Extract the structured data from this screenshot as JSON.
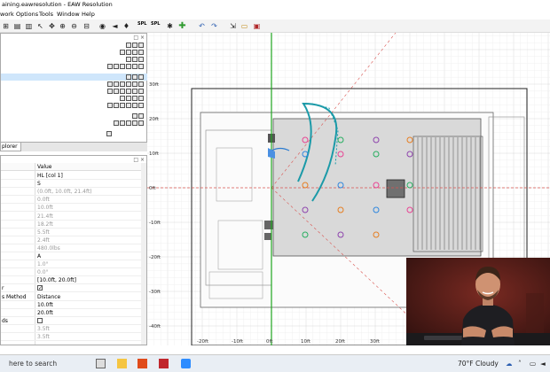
{
  "window": {
    "title": "aining.eawresolution - EAW Resolution"
  },
  "menu": [
    "work",
    "Options",
    "Tools",
    "Window",
    "Help"
  ],
  "toolbar": {
    "spl_label": "SPL"
  },
  "tree_panel": {
    "header": "□ ×"
  },
  "tabs": {
    "explorer": "plorer"
  },
  "props": {
    "header_value": "Value",
    "rows": [
      {
        "name": "",
        "value": "HL [col 1]",
        "dim": false,
        "check": ""
      },
      {
        "name": "",
        "value": "S",
        "dim": false,
        "check": ""
      },
      {
        "name": "",
        "value": "(0.0ft, 10.0ft, 21.4ft)",
        "dim": true,
        "check": ""
      },
      {
        "name": "",
        "value": "0.0ft",
        "dim": true,
        "check": ""
      },
      {
        "name": "",
        "value": "10.0ft",
        "dim": true,
        "check": ""
      },
      {
        "name": "",
        "value": "21.4ft",
        "dim": true,
        "check": ""
      },
      {
        "name": "",
        "value": "18.2ft",
        "dim": true,
        "check": ""
      },
      {
        "name": "",
        "value": "5.5ft",
        "dim": true,
        "check": ""
      },
      {
        "name": "",
        "value": "2.4ft",
        "dim": true,
        "check": ""
      },
      {
        "name": "",
        "value": "480.0lbs",
        "dim": true,
        "check": ""
      },
      {
        "name": "",
        "value": "A",
        "dim": false,
        "check": ""
      },
      {
        "name": "",
        "value": "1.0°",
        "dim": true,
        "check": ""
      },
      {
        "name": "",
        "value": "0.0°",
        "dim": true,
        "check": ""
      },
      {
        "name": "",
        "value": "[10.0ft, 20.0ft]",
        "dim": false,
        "check": ""
      },
      {
        "name": "r",
        "value": "",
        "dim": false,
        "check": "✓"
      },
      {
        "name": "s Method",
        "value": "Distance",
        "dim": false,
        "check": ""
      },
      {
        "name": "",
        "value": "10.0ft",
        "dim": false,
        "check": ""
      },
      {
        "name": "",
        "value": "20.0ft",
        "dim": false,
        "check": ""
      },
      {
        "name": "ds",
        "value": "",
        "dim": false,
        "check": " "
      },
      {
        "name": "",
        "value": "3.5ft",
        "dim": true,
        "check": ""
      },
      {
        "name": "",
        "value": "3.5ft",
        "dim": true,
        "check": ""
      }
    ]
  },
  "canvas": {
    "y_ticks": [
      "30ft",
      "20ft",
      "10ft",
      "0ft",
      "-10ft",
      "-20ft",
      "-30ft",
      "-40ft"
    ],
    "x_ticks": [
      "-20ft",
      "-10ft",
      "0ft",
      "10ft",
      "20ft",
      "30ft"
    ]
  },
  "taskbar": {
    "search_placeholder": "here to search",
    "weather": "70°F  Cloudy"
  },
  "colors": {
    "accent": "#2e7d32",
    "guide_red": "#d9534f",
    "webcam_bg": "#3a1715"
  }
}
